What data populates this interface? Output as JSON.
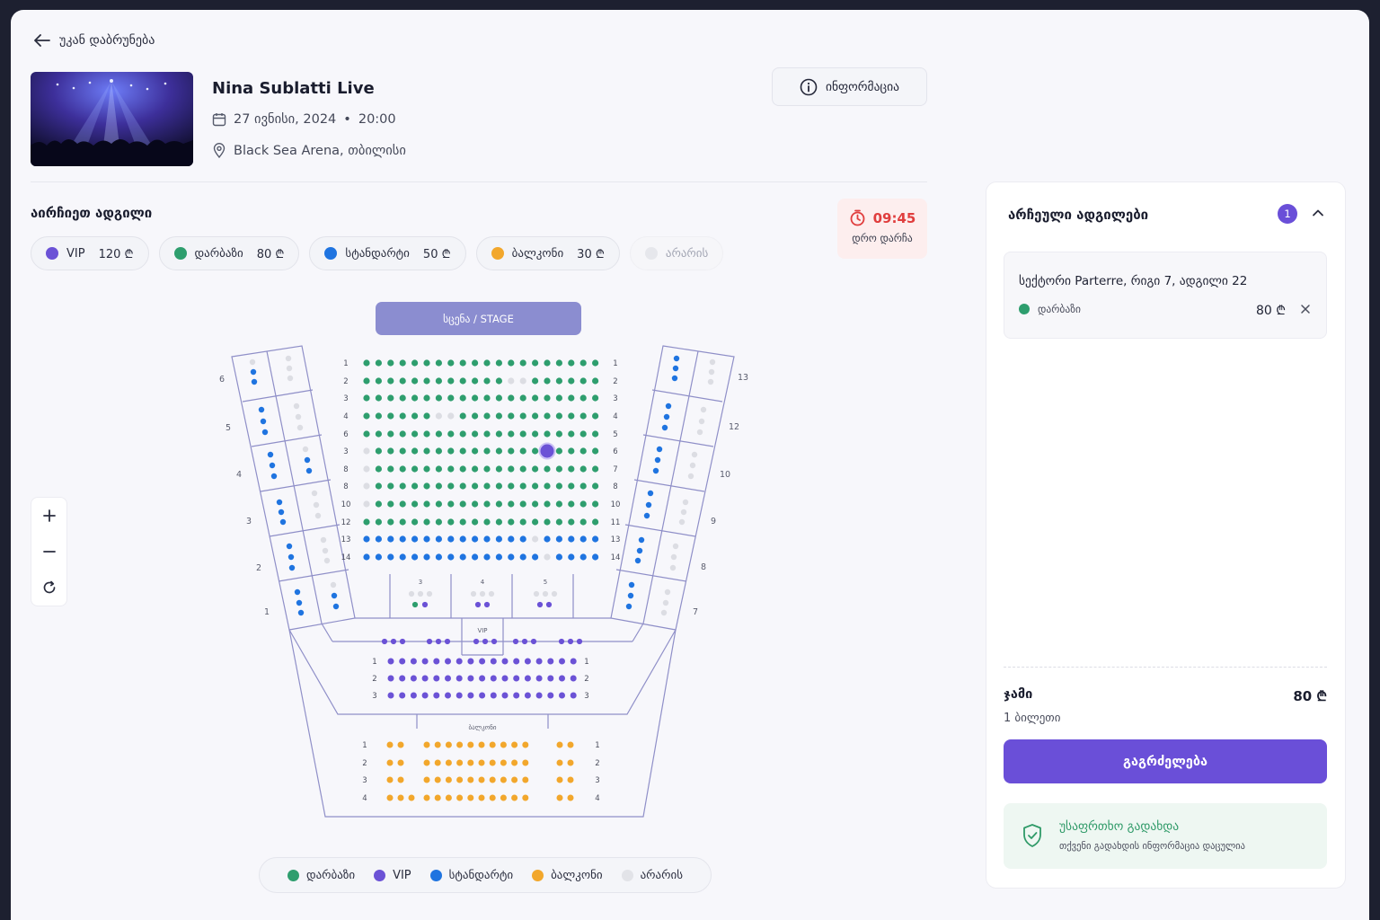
{
  "back_label": "უკან დაბრუნება",
  "event": {
    "title": "Nina Sublatti Live",
    "date": "27 ივნისი, 2024",
    "separator": "•",
    "time": "20:00",
    "venue": "Black Sea Arena, თბილისი"
  },
  "info_button": "ინფორმაცია",
  "seat_picker_title": "აირჩიეთ ადგილი",
  "timer": {
    "value": "09:45",
    "label": "დრო დარჩა"
  },
  "categories": [
    {
      "name": "VIP",
      "price": "120 ₾",
      "color": "#6b52d6"
    },
    {
      "name": "დარბაზი",
      "price": "80 ₾",
      "color": "#2e9e6e"
    },
    {
      "name": "სტანდარტი",
      "price": "50 ₾",
      "color": "#1f74e0"
    },
    {
      "name": "ბალკონი",
      "price": "30 ₾",
      "color": "#f2a72c"
    },
    {
      "name": "არარის",
      "price": "",
      "color": "#dcdde3"
    }
  ],
  "stage_label": "სცენა / STAGE",
  "vip_label": "VIP",
  "balcony_label": "ბალკონი",
  "box_labels": [
    "3",
    "4",
    "5"
  ],
  "left_blocks": [
    "6",
    "5",
    "4",
    "3",
    "2",
    "1"
  ],
  "right_blocks": [
    "13",
    "12",
    "10",
    "9",
    "8",
    "7"
  ],
  "parterre_rows_left": [
    "1",
    "2",
    "3",
    "4",
    "6",
    "3",
    "8",
    "8",
    "10",
    "12",
    "13",
    "14"
  ],
  "parterre_rows_right": [
    "1",
    "2",
    "3",
    "4",
    "5",
    "6",
    "7",
    "8",
    "10",
    "11",
    "13",
    "14"
  ],
  "vip_rows": [
    "1",
    "2",
    "3"
  ],
  "balcony_rows": [
    "1",
    "2",
    "3",
    "4"
  ],
  "legend": [
    {
      "name": "დარბაზი",
      "color": "#2e9e6e"
    },
    {
      "name": "VIP",
      "color": "#6b52d6"
    },
    {
      "name": "სტანდარტი",
      "color": "#1f74e0"
    },
    {
      "name": "ბალკონი",
      "color": "#f2a72c"
    },
    {
      "name": "არარის",
      "color": "#dcdde3"
    }
  ],
  "selected_panel": {
    "title": "არჩეული ადგილები",
    "count": "1",
    "ticket": {
      "label": "სექტორი Parterre, რიგი 7, ადგილი 22",
      "category": "დარბაზი",
      "price": "80 ₾"
    },
    "total_label": "ჯამი",
    "total_value": "80 ₾",
    "tickets_count": "1 ბილეთი",
    "continue_button": "გაგრძელება",
    "secure_title": "უსაფრთხო გადახდა",
    "secure_subtitle": "თქვენი გადახდის ინფორმაცია დაცულია"
  }
}
